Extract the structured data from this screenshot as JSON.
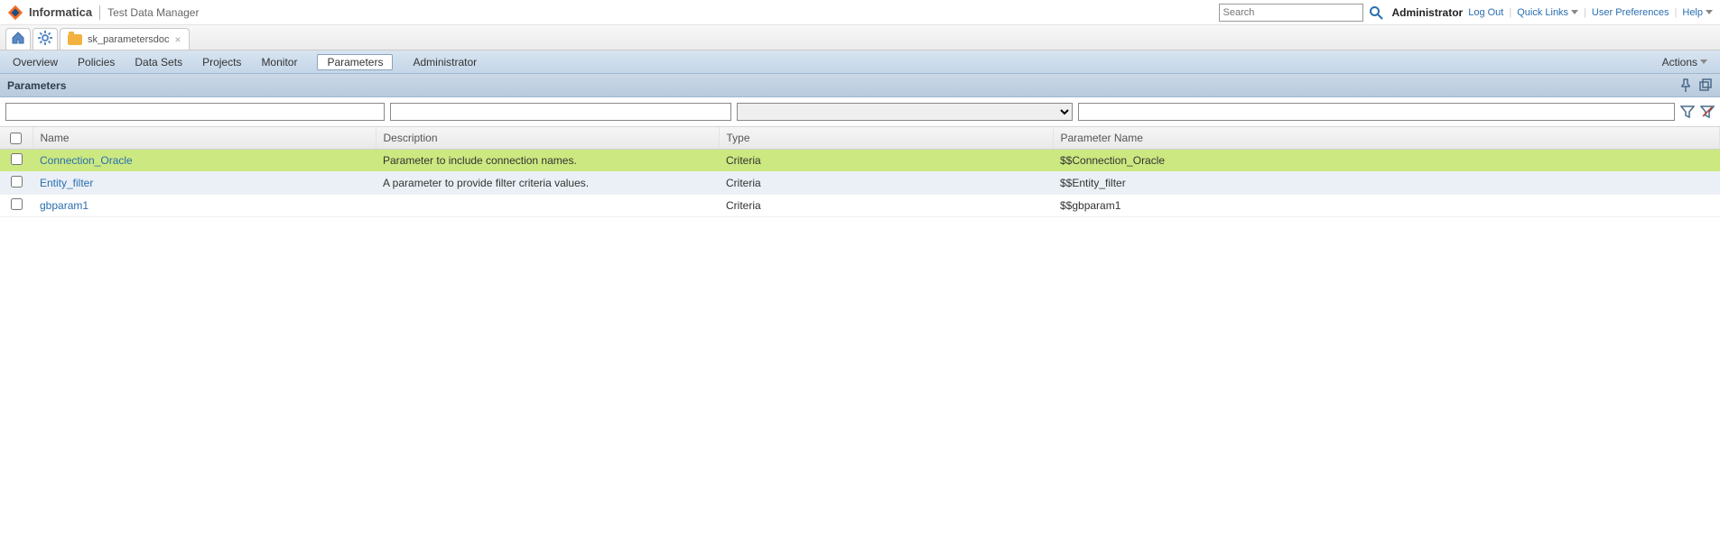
{
  "brand": {
    "company": "Informatica",
    "app": "Test Data Manager"
  },
  "top": {
    "search_placeholder": "Search",
    "user": "Administrator",
    "logout": "Log Out",
    "quicklinks": "Quick Links",
    "prefs": "User Preferences",
    "help": "Help"
  },
  "breadcrumb": {
    "tab_label": "sk_parametersdoc"
  },
  "subnav": {
    "items": [
      "Overview",
      "Policies",
      "Data Sets",
      "Projects",
      "Monitor",
      "Parameters",
      "Administrator"
    ],
    "active_index": 5,
    "actions": "Actions"
  },
  "panel": {
    "title": "Parameters"
  },
  "filters": {
    "name": "",
    "desc": "",
    "type": "",
    "pname": ""
  },
  "table": {
    "headers": {
      "name": "Name",
      "desc": "Description",
      "type": "Type",
      "pname": "Parameter Name"
    },
    "rows": [
      {
        "name": "Connection_Oracle",
        "desc": "Parameter to include connection names.",
        "type": "Criteria",
        "pname": "$$Connection_Oracle",
        "selected": true
      },
      {
        "name": "Entity_filter",
        "desc": "A parameter to provide filter criteria values.",
        "type": "Criteria",
        "pname": "$$Entity_filter",
        "selected": false
      },
      {
        "name": "gbparam1",
        "desc": "",
        "type": "Criteria",
        "pname": "$$gbparam1",
        "selected": false
      }
    ]
  }
}
